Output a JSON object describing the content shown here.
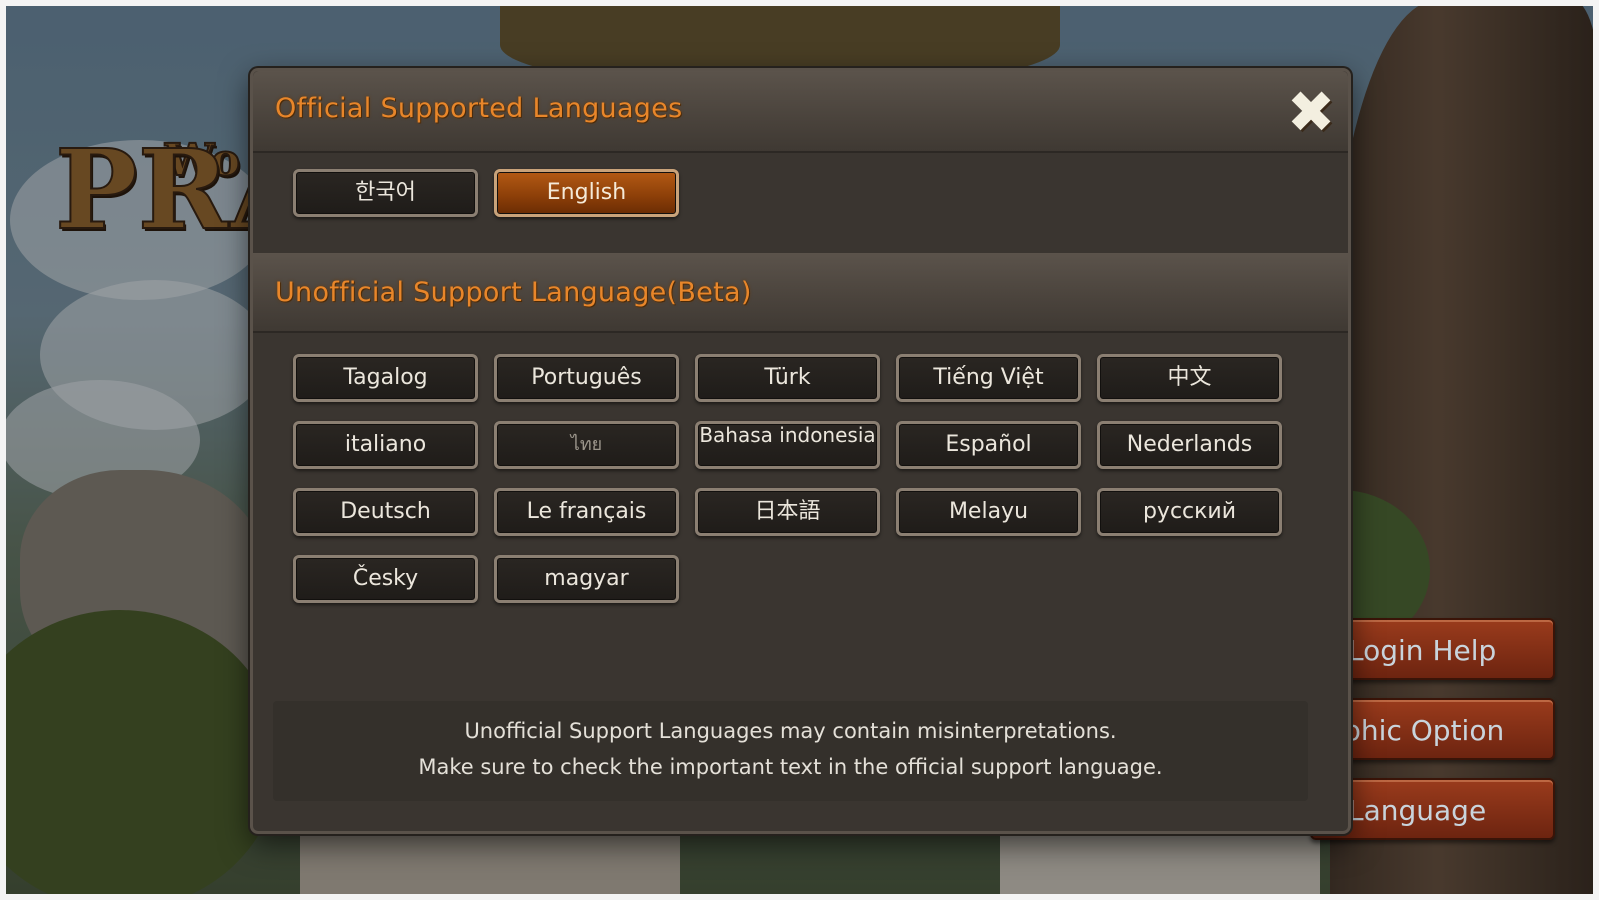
{
  "dialog": {
    "official_title": "Official Supported Languages",
    "unofficial_title": "Unofficial Support Language(Beta)",
    "close_glyph": "✖",
    "official_languages": [
      {
        "label": "한국어",
        "selected": false
      },
      {
        "label": "English",
        "selected": true
      }
    ],
    "unofficial_languages": [
      {
        "label": "Tagalog"
      },
      {
        "label": "Português"
      },
      {
        "label": "Türk"
      },
      {
        "label": "Tiếng Việt"
      },
      {
        "label": "中文"
      },
      {
        "label": "italiano"
      },
      {
        "label": "ไทย"
      },
      {
        "label": "Bahasa indonesia"
      },
      {
        "label": "Español"
      },
      {
        "label": "Nederlands"
      },
      {
        "label": "Deutsch"
      },
      {
        "label": "Le français"
      },
      {
        "label": "日本語"
      },
      {
        "label": "Melayu"
      },
      {
        "label": "русский"
      },
      {
        "label": "Česky"
      },
      {
        "label": "magyar"
      }
    ],
    "notice_line1": "Unofficial Support Languages may contain misinterpretations.",
    "notice_line2": "Make sure to check the important text in the official support language."
  },
  "side_menu": {
    "login_help": "Login Help",
    "graphic_option": "aphic Option",
    "language": "Language"
  },
  "logo": {
    "text_small": "Wo",
    "text_large": "PRA"
  },
  "colors": {
    "accent_orange": "#e8862a",
    "selected_button": "#b35a14",
    "dialog_bg": "#3a3530",
    "side_button": "#9a3b1c"
  }
}
